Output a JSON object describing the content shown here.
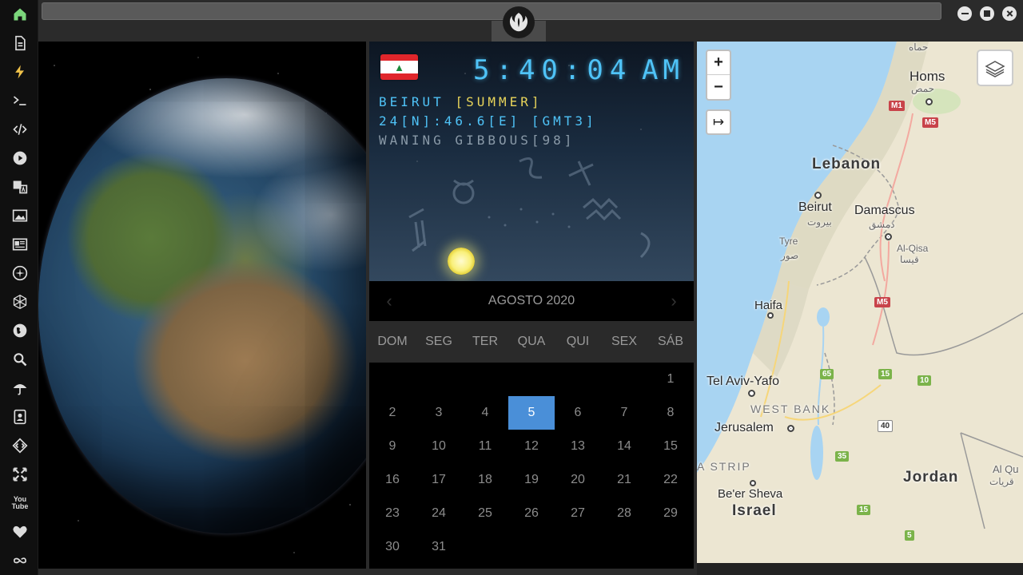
{
  "sidebar": {
    "items": [
      {
        "icon": "home-icon",
        "active": true
      },
      {
        "icon": "document-icon"
      },
      {
        "icon": "lightning-icon"
      },
      {
        "icon": "terminal-icon"
      },
      {
        "icon": "code-icon"
      },
      {
        "icon": "play-icon"
      },
      {
        "icon": "translate-icon"
      },
      {
        "icon": "image-icon"
      },
      {
        "icon": "newspaper-icon"
      },
      {
        "icon": "rebel-alliance-icon"
      },
      {
        "icon": "hexagon-icon"
      },
      {
        "icon": "globe-icon"
      },
      {
        "icon": "search-icon"
      },
      {
        "icon": "umbrella-icon"
      },
      {
        "icon": "contact-card-icon"
      },
      {
        "icon": "diamond-code-icon"
      },
      {
        "icon": "expand-arrows-icon"
      },
      {
        "icon": "youtube-icon"
      },
      {
        "icon": "heart-icon"
      },
      {
        "icon": "infinity-cloud-icon"
      }
    ],
    "youtube_text": "You Tube"
  },
  "colors": {
    "accent": "#4fc3f7",
    "season": "#e8d45a",
    "today": "#4a8fd8",
    "active_sidebar": "#7bd67b"
  },
  "clock": {
    "time": "5:40:04",
    "ampm": "AM",
    "city": "BEIRUT ",
    "season": "[SUMMER]",
    "coords": "24[N]:46.6[E] [GMT3]",
    "moon": "WANING GIBBOUS[98]"
  },
  "calendar": {
    "month_label": "AGOSTO 2020",
    "prev": "‹",
    "next": "›",
    "weekdays": [
      "DOM",
      "SEG",
      "TER",
      "QUA",
      "QUI",
      "SEX",
      "SÁB"
    ],
    "weeks": [
      [
        "",
        "",
        "",
        "",
        "",
        "",
        "1"
      ],
      [
        "2",
        "3",
        "4",
        "5",
        "6",
        "7",
        "8"
      ],
      [
        "9",
        "10",
        "11",
        "12",
        "13",
        "14",
        "15"
      ],
      [
        "16",
        "17",
        "18",
        "19",
        "20",
        "21",
        "22"
      ],
      [
        "23",
        "24",
        "25",
        "26",
        "27",
        "28",
        "29"
      ],
      [
        "30",
        "31",
        "",
        "",
        "",
        "",
        ""
      ]
    ],
    "today": "5"
  },
  "map": {
    "zoom_in": "+",
    "zoom_out": "−",
    "expand": "↦",
    "labels": {
      "hama": "حماه",
      "homs": "Homs",
      "homs_ar": "حمص",
      "lebanon": "Lebanon",
      "beirut": "Beirut",
      "beirut_ar": "بيروت",
      "damascus": "Damascus",
      "damascus_ar": "دمشق",
      "tyre": "Tyre",
      "tyre_ar": "صور",
      "alqisa": "Al-Qisa",
      "alqisa_ar": "قيسا",
      "haifa": "Haifa",
      "telaviv": "Tel Aviv-Yafo",
      "westbank": "WEST BANK",
      "jerusalem": "Jerusalem",
      "gaza": "A STRIP",
      "jordan": "Jordan",
      "beersheva": "Be'er Sheva",
      "israel": "Israel",
      "alqu": "Al Qu",
      "alqu_ar": "قريات"
    },
    "shields": {
      "m1": "M1",
      "m5a": "M5",
      "m5b": "M5",
      "r65": "65",
      "r15a": "15",
      "r10": "10",
      "r40": "40",
      "r35": "35",
      "r15b": "15",
      "r5": "5"
    }
  }
}
